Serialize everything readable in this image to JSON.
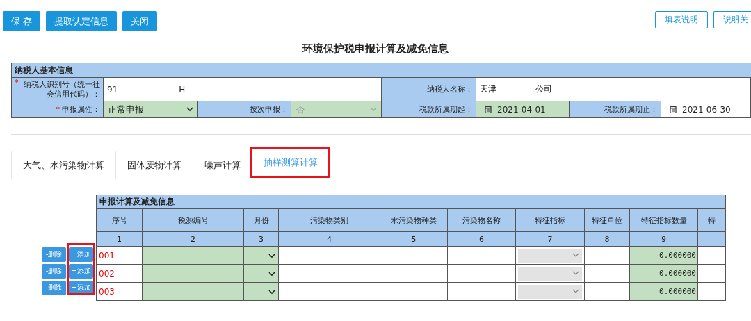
{
  "toolbar": {
    "buttons": [
      {
        "label": "保 存"
      },
      {
        "label": "提取认定信息"
      },
      {
        "label": "关闭"
      }
    ],
    "help_buttons": [
      {
        "label": "填表说明"
      },
      {
        "label": "说明关"
      }
    ]
  },
  "title": "环境保护税申报计算及减免信息",
  "taxpayer_info": {
    "heading": "纳税人基本信息",
    "id_field": {
      "label": "纳税人识别号（统一社会信用代码）：",
      "required_mark": "*",
      "value": "91",
      "value_tail": "H"
    },
    "name_field": {
      "label": "纳税人名称：",
      "value": "天津",
      "value_tail": "公司"
    },
    "declare_type": {
      "label": "申报属性：",
      "required_mark": "*",
      "value": "正常申报",
      "disabled": false
    },
    "by_count": {
      "label": "按次申报：",
      "value": "否",
      "disabled": true
    },
    "period_start": {
      "label": "税款所属期起：",
      "value": "2021-04-01",
      "editable": true
    },
    "period_end": {
      "label": "税款所属期止：",
      "value": "2021-06-30",
      "editable": false
    }
  },
  "tabs": [
    {
      "label": "大气、水污染物计算",
      "selected": false,
      "highlighted": false
    },
    {
      "label": "固体废物计算",
      "selected": false,
      "highlighted": false
    },
    {
      "label": "噪声计算",
      "selected": false,
      "highlighted": false
    },
    {
      "label": "抽样测算计算",
      "selected": true,
      "highlighted": true
    }
  ],
  "calc_table": {
    "heading": "申报计算及减免信息",
    "add_buttons_highlighted": true,
    "columns": [
      {
        "header": "序号",
        "number": "1",
        "kind": "seq"
      },
      {
        "header": "税源编号",
        "number": "2",
        "kind": "input"
      },
      {
        "header": "月份",
        "number": "3",
        "kind": "select"
      },
      {
        "header": "污染物类别",
        "number": "4",
        "kind": "blank"
      },
      {
        "header": "水污染物种类",
        "number": "5",
        "kind": "blank"
      },
      {
        "header": "污染物名称",
        "number": "6",
        "kind": "blank"
      },
      {
        "header": "特征指标",
        "number": "7",
        "kind": "disabled_select"
      },
      {
        "header": "特征单位",
        "number": "8",
        "kind": "blank"
      },
      {
        "header": "特征指标数量",
        "number": "9",
        "kind": "quantity"
      },
      {
        "header": "特",
        "kind": "blank"
      }
    ],
    "rows": [
      {
        "seq": "001",
        "quantity": "0.000000",
        "delete_label": "-删除",
        "add_label": "+添加"
      },
      {
        "seq": "002",
        "quantity": "0.000000",
        "delete_label": "-删除",
        "add_label": "+添加"
      },
      {
        "seq": "003",
        "quantity": "0.000000",
        "delete_label": "-删除",
        "add_label": "+添加"
      }
    ]
  }
}
